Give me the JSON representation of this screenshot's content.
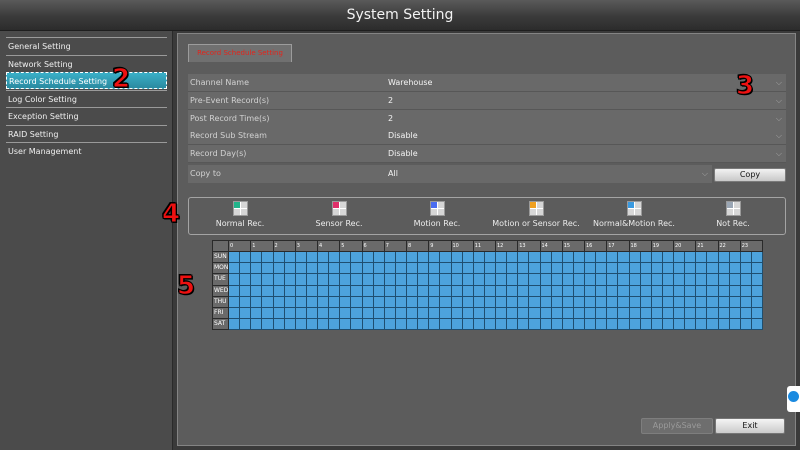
{
  "window": {
    "title": "System Setting"
  },
  "sidebar": {
    "items": [
      {
        "label": "General Setting",
        "active": false
      },
      {
        "label": "Network Setting",
        "active": false
      },
      {
        "label": "Record Schedule Setting",
        "active": true
      },
      {
        "label": "Log Color Setting",
        "active": false
      },
      {
        "label": "Exception Setting",
        "active": false
      },
      {
        "label": "RAID Setting",
        "active": false
      },
      {
        "label": "User Management",
        "active": false
      }
    ]
  },
  "main": {
    "tab_label": "Record Schedule Setting",
    "fields": [
      {
        "label": "Channel Name",
        "value": "Warehouse"
      },
      {
        "label": "Pre-Event Record(s)",
        "value": "2"
      },
      {
        "label": "Post Record Time(s)",
        "value": "2"
      },
      {
        "label": "Record Sub Stream",
        "value": "Disable"
      },
      {
        "label": "Record Day(s)",
        "value": "Disable"
      }
    ],
    "copy_to": {
      "label": "Copy to",
      "value": "All",
      "button_label": "Copy"
    },
    "legend": [
      {
        "label": "Normal Rec.",
        "color": "#22b38a"
      },
      {
        "label": "Sensor Rec.",
        "color": "#e0306a"
      },
      {
        "label": "Motion Rec.",
        "color": "#4a6cf0"
      },
      {
        "label": "Motion or Sensor Rec.",
        "color": "#f0a020"
      },
      {
        "label": "Normal&Motion Rec.",
        "color": "#3a9ae0"
      },
      {
        "label": "Not Rec.",
        "color": "#9aa6b4"
      }
    ],
    "schedule": {
      "hours": [
        "0",
        "1",
        "2",
        "3",
        "4",
        "5",
        "6",
        "7",
        "8",
        "9",
        "10",
        "11",
        "12",
        "13",
        "14",
        "15",
        "16",
        "17",
        "18",
        "19",
        "20",
        "21",
        "22",
        "23"
      ],
      "days": [
        "SUN",
        "MON",
        "TUE",
        "WED",
        "THU",
        "FRI",
        "SAT"
      ],
      "cell_color": "#4da3dc"
    },
    "buttons": {
      "apply_label": "Apply&Save",
      "exit_label": "Exit"
    }
  },
  "annotations": {
    "sidebar_marker": "2",
    "form_marker": "3",
    "legend_marker": "4",
    "grid_marker": "5"
  }
}
